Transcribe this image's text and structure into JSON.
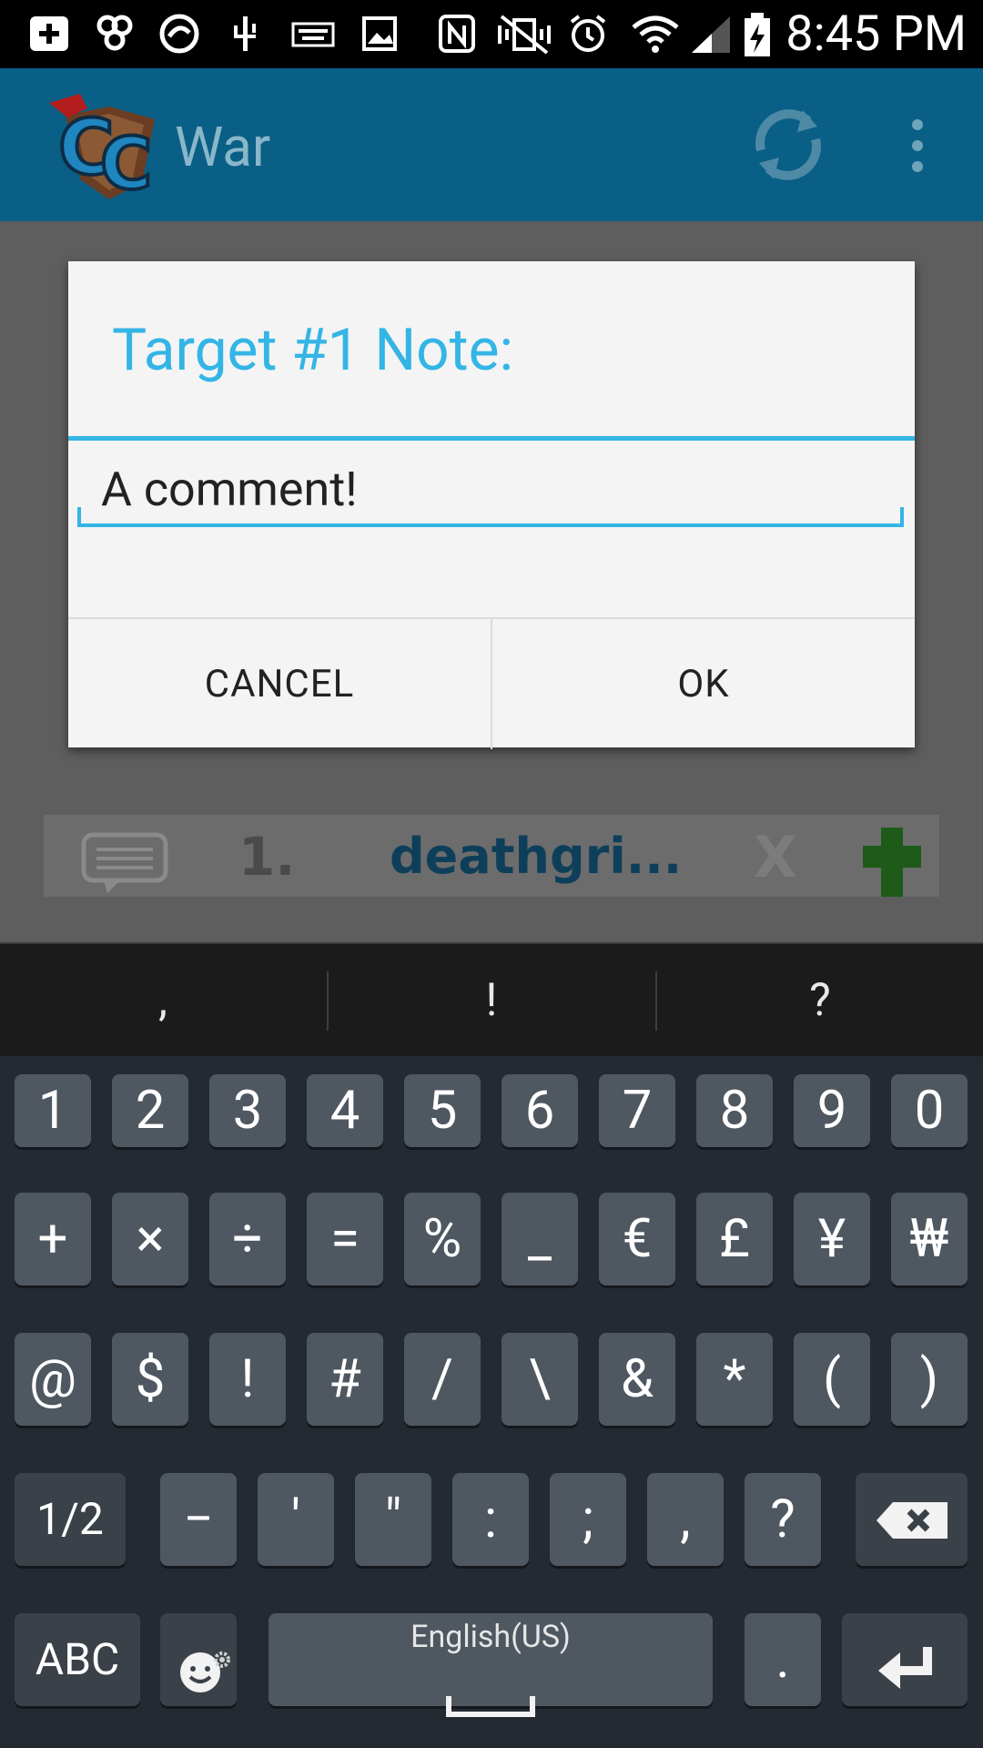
{
  "status_bar": {
    "time": "8:45 PM"
  },
  "action_bar": {
    "title": "War"
  },
  "background_list": {
    "row_number": "1.",
    "player_name": "deathgri...",
    "x_mark": "X"
  },
  "dialog": {
    "title": "Target #1 Note:",
    "input_value": "A comment!",
    "cancel_label": "CANCEL",
    "ok_label": "OK"
  },
  "keyboard": {
    "suggestions": [
      ",",
      "!",
      "?"
    ],
    "rows": [
      [
        "1",
        "2",
        "3",
        "4",
        "5",
        "6",
        "7",
        "8",
        "9",
        "0"
      ],
      [
        "+",
        "×",
        "÷",
        "=",
        "%",
        "_",
        "€",
        "£",
        "¥",
        "₩"
      ],
      [
        "@",
        "$",
        "!",
        "#",
        "/",
        "\\",
        "&",
        "*",
        "(",
        ")"
      ],
      [
        "1/2",
        "−",
        "'",
        "\"",
        ":",
        ";",
        ",",
        "?"
      ]
    ],
    "abc_label": "ABC",
    "space_label": "English(US)",
    "period_label": "."
  },
  "colors": {
    "accent": "#33b5e5",
    "action_bar": "#0a5f86",
    "keyboard_bg": "#242a31",
    "key_bg": "#4f5761"
  }
}
